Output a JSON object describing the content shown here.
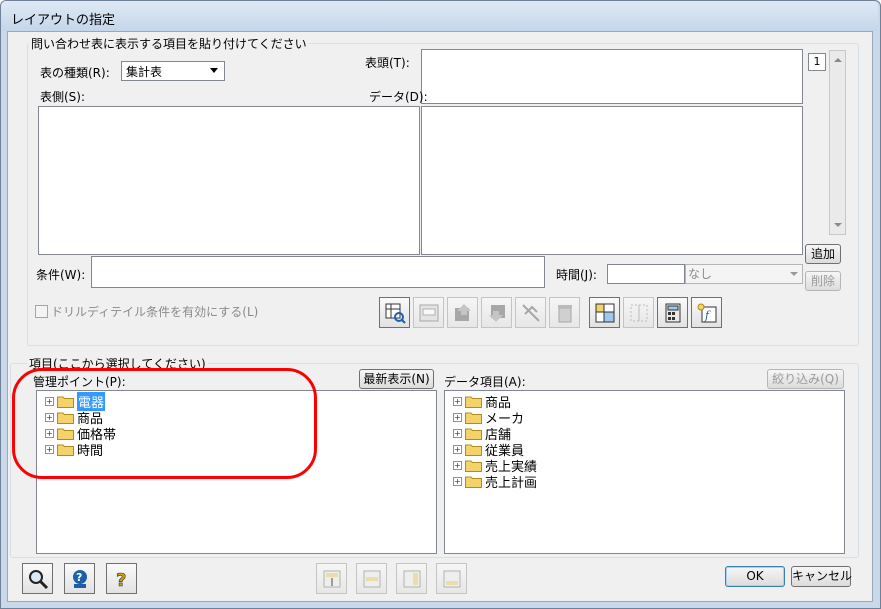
{
  "window": {
    "title": "レイアウトの指定"
  },
  "paste_group": {
    "label": "問い合わせ表に表示する項目を貼り付けてください",
    "table_type_label": "表の種類(R):",
    "table_type_value": "集計表",
    "head_label": "表頭(T):",
    "side_label": "表側(S):",
    "data_label": "データ(D):",
    "page_number": "1",
    "add_button": "追加",
    "condition_label": "条件(W):",
    "condition_value": "",
    "time_label": "時間(J):",
    "time_value": "",
    "time_select": "なし",
    "delete_button": "削除",
    "drill_checkbox": "ドリルディテイル条件を有効にする(L)"
  },
  "items_group": {
    "label": "項目(ここから選択してください)",
    "mgmt_label": "管理ポイント(P):",
    "refresh_button": "最新表示(N)",
    "data_items_label": "データ項目(A):",
    "filter_button": "絞り込み(Q)",
    "mgmt_items": [
      "電器",
      "商品",
      "価格帯",
      "時間"
    ],
    "data_items": [
      "商品",
      "メーカ",
      "店舗",
      "従業員",
      "売上実績",
      "売上計画"
    ]
  },
  "footer": {
    "ok": "OK",
    "cancel": "キャンセル"
  },
  "colors": {
    "highlight_circle": "#ff0000",
    "selection": "#3399ff",
    "folder": "#f5d36b"
  }
}
